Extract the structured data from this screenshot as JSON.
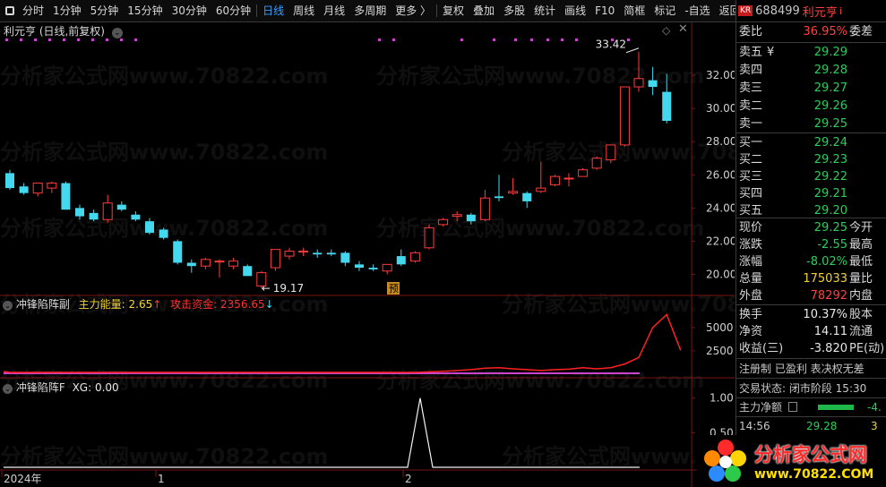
{
  "toolbar": {
    "items": [
      "分时",
      "1分钟",
      "5分钟",
      "15分钟",
      "30分钟",
      "60分钟",
      "日线",
      "周线",
      "月线",
      "多周期",
      "更多 〉",
      "复权",
      "叠加",
      "多股",
      "统计",
      "画线",
      "F10",
      "简框",
      "标记",
      "-自选",
      "返回"
    ],
    "active": "日线"
  },
  "chart_title": "利元亨 (日线,前复权)",
  "watermark": "分析家公式网www.70822.com",
  "main_panel": {
    "y_ticks": [
      "32.00",
      "30.00",
      "28.00",
      "26.00",
      "24.00",
      "22.00",
      "20.00"
    ],
    "high_label": "33.42",
    "low_label": "19.17",
    "pre_badge": "预"
  },
  "sub_panel1": {
    "name": "冲锋陷阵副",
    "main_energy_label": "主力能量:",
    "main_energy_value": "2.65",
    "attack_label": "攻击资金:",
    "attack_value": "2356.65",
    "y_ticks": [
      "5000",
      "2500"
    ]
  },
  "sub_panel2": {
    "name": "冲锋陷阵F",
    "xg_label": "XG:",
    "xg_value": "0.00",
    "y_ticks": [
      "1.00",
      "0.50"
    ]
  },
  "x_axis": {
    "labels": [
      "2024年",
      "1",
      "2"
    ]
  },
  "colors": {
    "up": "#ff3b3b",
    "down": "#44d8ee",
    "grid": "#8b1010",
    "axis": "#7a1515",
    "energy": "#f0d23a",
    "attack": "#ff2020",
    "magenta": "#cc44cc"
  },
  "chart_data": [
    {
      "type": "candlestick",
      "title": "利元亨 (日线,前复权)",
      "ylim": [
        19.0,
        34.0
      ],
      "candles": [
        {
          "o": 26.1,
          "h": 26.3,
          "l": 25.1,
          "c": 25.2
        },
        {
          "o": 25.3,
          "h": 25.5,
          "l": 24.8,
          "c": 24.9
        },
        {
          "o": 24.9,
          "h": 25.5,
          "l": 24.7,
          "c": 25.5
        },
        {
          "o": 25.2,
          "h": 25.6,
          "l": 24.9,
          "c": 25.5
        },
        {
          "o": 25.5,
          "h": 25.6,
          "l": 23.9,
          "c": 23.9
        },
        {
          "o": 24.0,
          "h": 24.2,
          "l": 23.3,
          "c": 23.5
        },
        {
          "o": 23.7,
          "h": 23.9,
          "l": 23.2,
          "c": 23.3
        },
        {
          "o": 23.3,
          "h": 24.8,
          "l": 23.1,
          "c": 24.3
        },
        {
          "o": 24.2,
          "h": 24.4,
          "l": 23.8,
          "c": 23.9
        },
        {
          "o": 23.6,
          "h": 23.8,
          "l": 23.2,
          "c": 23.3
        },
        {
          "o": 23.2,
          "h": 23.4,
          "l": 22.4,
          "c": 22.5
        },
        {
          "o": 22.7,
          "h": 22.8,
          "l": 22.1,
          "c": 22.2
        },
        {
          "o": 22.0,
          "h": 22.1,
          "l": 20.6,
          "c": 20.7
        },
        {
          "o": 20.7,
          "h": 20.9,
          "l": 20.1,
          "c": 20.5
        },
        {
          "o": 20.5,
          "h": 21.0,
          "l": 20.3,
          "c": 20.9
        },
        {
          "o": 20.8,
          "h": 20.9,
          "l": 19.8,
          "c": 20.8
        },
        {
          "o": 20.5,
          "h": 21.0,
          "l": 20.3,
          "c": 20.8
        },
        {
          "o": 20.5,
          "h": 20.6,
          "l": 19.9,
          "c": 19.9
        },
        {
          "o": 19.3,
          "h": 20.2,
          "l": 19.17,
          "c": 20.1
        },
        {
          "o": 20.4,
          "h": 21.5,
          "l": 20.2,
          "c": 21.5
        },
        {
          "o": 21.1,
          "h": 21.6,
          "l": 20.9,
          "c": 21.4
        },
        {
          "o": 21.4,
          "h": 21.6,
          "l": 21.1,
          "c": 21.4
        },
        {
          "o": 21.3,
          "h": 21.5,
          "l": 21.0,
          "c": 21.2
        },
        {
          "o": 21.3,
          "h": 21.5,
          "l": 21.1,
          "c": 21.2
        },
        {
          "o": 21.3,
          "h": 21.4,
          "l": 20.5,
          "c": 20.7
        },
        {
          "o": 20.6,
          "h": 20.8,
          "l": 20.2,
          "c": 20.4
        },
        {
          "o": 20.4,
          "h": 20.6,
          "l": 20.2,
          "c": 20.3
        },
        {
          "o": 20.2,
          "h": 20.6,
          "l": 20.0,
          "c": 20.6
        },
        {
          "o": 21.1,
          "h": 21.5,
          "l": 20.5,
          "c": 20.6
        },
        {
          "o": 20.8,
          "h": 21.4,
          "l": 20.7,
          "c": 21.3
        },
        {
          "o": 21.6,
          "h": 23.0,
          "l": 21.5,
          "c": 22.8
        },
        {
          "o": 23.0,
          "h": 23.4,
          "l": 22.9,
          "c": 23.3
        },
        {
          "o": 23.5,
          "h": 23.8,
          "l": 23.2,
          "c": 23.6
        },
        {
          "o": 23.6,
          "h": 23.7,
          "l": 23.0,
          "c": 23.2
        },
        {
          "o": 23.3,
          "h": 25.1,
          "l": 23.2,
          "c": 24.6
        },
        {
          "o": 24.7,
          "h": 26.0,
          "l": 24.4,
          "c": 24.6
        },
        {
          "o": 24.9,
          "h": 25.8,
          "l": 24.8,
          "c": 25.0
        },
        {
          "o": 24.9,
          "h": 25.0,
          "l": 24.0,
          "c": 24.4
        },
        {
          "o": 25.0,
          "h": 26.8,
          "l": 24.9,
          "c": 25.2
        },
        {
          "o": 25.4,
          "h": 26.0,
          "l": 25.3,
          "c": 25.9
        },
        {
          "o": 25.8,
          "h": 26.1,
          "l": 25.3,
          "c": 25.8
        },
        {
          "o": 25.9,
          "h": 26.4,
          "l": 25.9,
          "c": 26.3
        },
        {
          "o": 26.4,
          "h": 27.1,
          "l": 26.3,
          "c": 27.0
        },
        {
          "o": 26.9,
          "h": 27.8,
          "l": 26.7,
          "c": 27.8
        },
        {
          "o": 27.8,
          "h": 28.5,
          "l": 27.7,
          "c": 31.3
        },
        {
          "o": 31.3,
          "h": 33.42,
          "l": 31.0,
          "c": 31.8
        },
        {
          "o": 31.7,
          "h": 32.5,
          "l": 30.8,
          "c": 31.3
        },
        {
          "o": 31.0,
          "h": 32.1,
          "l": 29.1,
          "c": 29.25
        }
      ],
      "y_ticks": [
        32,
        30,
        28,
        26,
        24,
        22,
        20
      ],
      "high_label": "33.42",
      "low_label": "19.17"
    },
    {
      "type": "line",
      "title": "冲锋陷阵副",
      "ylim": [
        0,
        7000
      ],
      "y_ticks": [
        5000,
        2500
      ],
      "series": [
        {
          "name": "攻击资金",
          "values": [
            0,
            0,
            0,
            0,
            0,
            0,
            0,
            0,
            0,
            0,
            0,
            0,
            0,
            0,
            0,
            0,
            0,
            0,
            0,
            0,
            0,
            0,
            0,
            0,
            0,
            0,
            0,
            0,
            0,
            0,
            60,
            120,
            200,
            300,
            450,
            500,
            380,
            300,
            200,
            300,
            350,
            500,
            380,
            500,
            900,
            1600,
            4800,
            6200,
            2356.65
          ]
        }
      ]
    },
    {
      "type": "line",
      "title": "冲锋陷阵F",
      "ylim": [
        0,
        1.1
      ],
      "y_ticks": [
        1.0,
        0.5
      ],
      "series": [
        {
          "name": "XG",
          "values": [
            0,
            0,
            0,
            0,
            0,
            0,
            0,
            0,
            0,
            0,
            0,
            0,
            0,
            0,
            0,
            0,
            0,
            0,
            0,
            0,
            0,
            0,
            0,
            0,
            0,
            0,
            0,
            0,
            0,
            1,
            0,
            0,
            0,
            0,
            0,
            0,
            0,
            0,
            0,
            0,
            0,
            0,
            0,
            0,
            0,
            0,
            0,
            0,
            0
          ]
        }
      ]
    }
  ],
  "side": {
    "badge": "KR",
    "code": "688499",
    "name": "利元亨",
    "info": "i",
    "weibi_label": "委比",
    "weibi_value": "36.95%",
    "weicha_label": "委差",
    "asks": [
      {
        "label": "卖五",
        "price": "29.29",
        "mark": "¥"
      },
      {
        "label": "卖四",
        "price": "29.28",
        "mark": ""
      },
      {
        "label": "卖三",
        "price": "29.27",
        "mark": ""
      },
      {
        "label": "卖二",
        "price": "29.26",
        "mark": ""
      },
      {
        "label": "卖一",
        "price": "29.25",
        "mark": ""
      }
    ],
    "bids": [
      {
        "label": "买一",
        "price": "29.24"
      },
      {
        "label": "买二",
        "price": "29.23"
      },
      {
        "label": "买三",
        "price": "29.22"
      },
      {
        "label": "买四",
        "price": "29.21"
      },
      {
        "label": "买五",
        "price": "29.20"
      }
    ],
    "quote": [
      {
        "l": "现价",
        "v": "29.25",
        "vc": "green",
        "r": "今开"
      },
      {
        "l": "涨跌",
        "v": "-2.55",
        "vc": "green",
        "r": "最高"
      },
      {
        "l": "涨幅",
        "v": "-8.02%",
        "vc": "green",
        "r": "最低"
      },
      {
        "l": "总量",
        "v": "175033",
        "vc": "yellow",
        "r": "量比"
      },
      {
        "l": "外盘",
        "v": "78292",
        "vc": "red",
        "r": "内盘"
      }
    ],
    "fund": [
      {
        "l": "换手",
        "v": "10.37%",
        "vc": "white",
        "r": "股本"
      },
      {
        "l": "净资",
        "v": "14.11",
        "vc": "white",
        "r": "流通"
      },
      {
        "l": "收益(三)",
        "v": "-3.820",
        "vc": "white",
        "r": "PE(动)"
      }
    ],
    "reg_line": "注册制 已盈利 表决权无差",
    "trade_status": "交易状态: 闭市阶段 15:30",
    "net_label": "主力净额",
    "net_value": "-4.",
    "tick_time": "14:56",
    "tick_price": "29.28",
    "tick_vol": "3"
  },
  "logo": {
    "text": "分析家公式网",
    "url": "www.70822.COM"
  }
}
